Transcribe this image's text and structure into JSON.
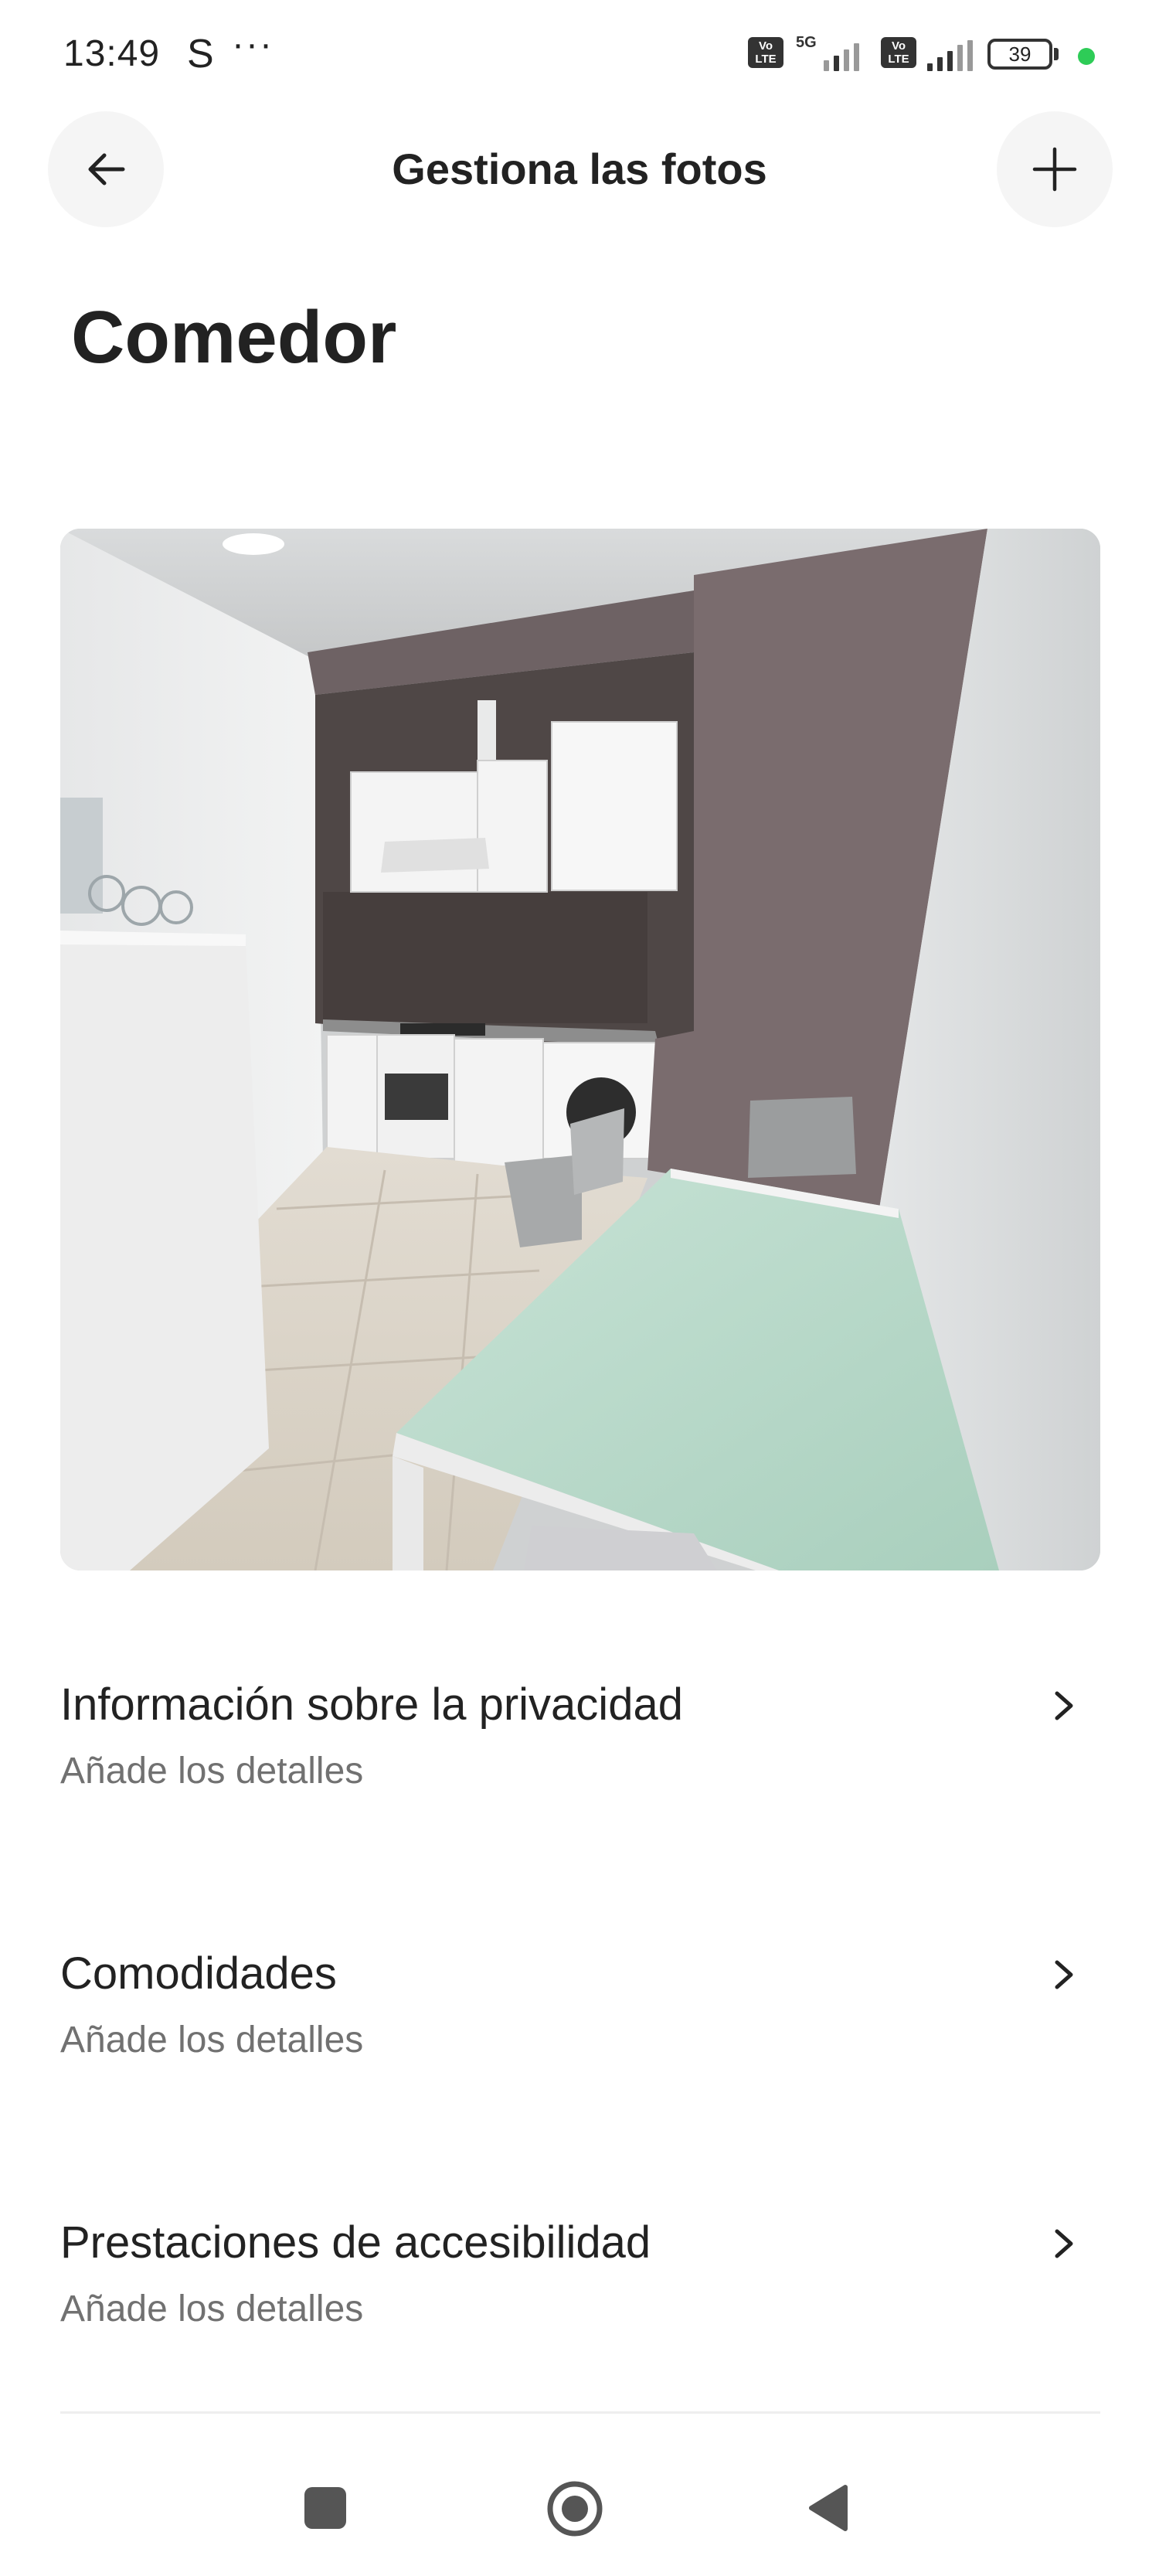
{
  "status_bar": {
    "time": "13:49",
    "carrier_icon": "S",
    "more": "···",
    "volte_label": "Vo LTE",
    "network": "5G",
    "battery": "39"
  },
  "header": {
    "title": "Gestiona las fotos",
    "back_icon": "arrow-left-icon",
    "add_icon": "plus-icon"
  },
  "room": {
    "title": "Comedor"
  },
  "settings": [
    {
      "title": "Información sobre la privacidad",
      "subtitle": "Añade los detalles"
    },
    {
      "title": "Comodidades",
      "subtitle": "Añade los detalles"
    },
    {
      "title": "Prestaciones de accesibilidad",
      "subtitle": "Añade los detalles"
    }
  ],
  "colors": {
    "text": "#222222",
    "subtext": "#717171",
    "button_bg": "#f5f5f5",
    "status_green": "#2ecc57"
  }
}
